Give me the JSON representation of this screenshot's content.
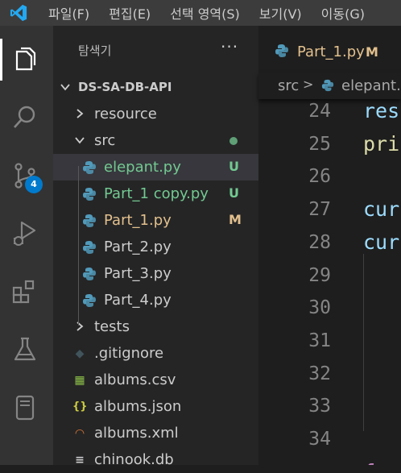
{
  "menu": [
    "파일(F)",
    "편집(E)",
    "선택 영역(S)",
    "보기(V)",
    "이동(G)"
  ],
  "activity_bar": {
    "items": [
      "explorer-icon",
      "search-icon",
      "source-control-icon",
      "run-debug-icon",
      "extensions-icon",
      "testing-icon",
      "remote-explorer-icon"
    ],
    "scm_badge": "4"
  },
  "explorer": {
    "title": "탐색기",
    "more": "···",
    "root": "DS-SA-DB-API",
    "items": [
      {
        "label": "resource",
        "type": "folder",
        "expanded": false
      },
      {
        "label": "src",
        "type": "folder",
        "expanded": true
      },
      {
        "label": "elepant.py",
        "type": "python",
        "decoration": "U",
        "color": "#73c991"
      },
      {
        "label": "Part_1 copy.py",
        "type": "python",
        "decoration": "U",
        "color": "#73c991"
      },
      {
        "label": "Part_1.py",
        "type": "python",
        "decoration": "M",
        "color": "#e2c08d"
      },
      {
        "label": "Part_2.py",
        "type": "python"
      },
      {
        "label": "Part_3.py",
        "type": "python"
      },
      {
        "label": "Part_4.py",
        "type": "python"
      },
      {
        "label": "tests",
        "type": "folder",
        "expanded": false
      },
      {
        "label": ".gitignore",
        "type": "gitignore"
      },
      {
        "label": "albums.csv",
        "type": "csv"
      },
      {
        "label": "albums.json",
        "type": "json"
      },
      {
        "label": "albums.xml",
        "type": "xml"
      },
      {
        "label": "chinook.db",
        "type": "db"
      }
    ]
  },
  "editor": {
    "tab": {
      "label": "Part_1.py",
      "decoration": "M"
    },
    "breadcrumb": {
      "folder": "src",
      "separator": ">",
      "file": "elepant.py"
    },
    "lines": [
      {
        "number": "24",
        "text": "res",
        "color": "#9cdcfe"
      },
      {
        "number": "25",
        "text": "pri",
        "color": "#dcdcaa"
      },
      {
        "number": "26",
        "text": "",
        "color": "#d4d4d4"
      },
      {
        "number": "27",
        "text": "cur",
        "color": "#9cdcfe"
      },
      {
        "number": "28",
        "text": "cur",
        "color": "#9cdcfe"
      },
      {
        "number": "29",
        "text": "",
        "color": "#d4d4d4"
      },
      {
        "number": "30",
        "text": "",
        "color": "#d4d4d4"
      },
      {
        "number": "31",
        "text": "",
        "color": "#d4d4d4"
      },
      {
        "number": "32",
        "text": "",
        "color": "#d4d4d4"
      },
      {
        "number": "33",
        "text": "",
        "color": "#d4d4d4"
      },
      {
        "number": "34",
        "text": "",
        "color": "#d4d4d4"
      },
      {
        "number": "",
        "text": "for",
        "color": "#c586c0"
      }
    ]
  }
}
